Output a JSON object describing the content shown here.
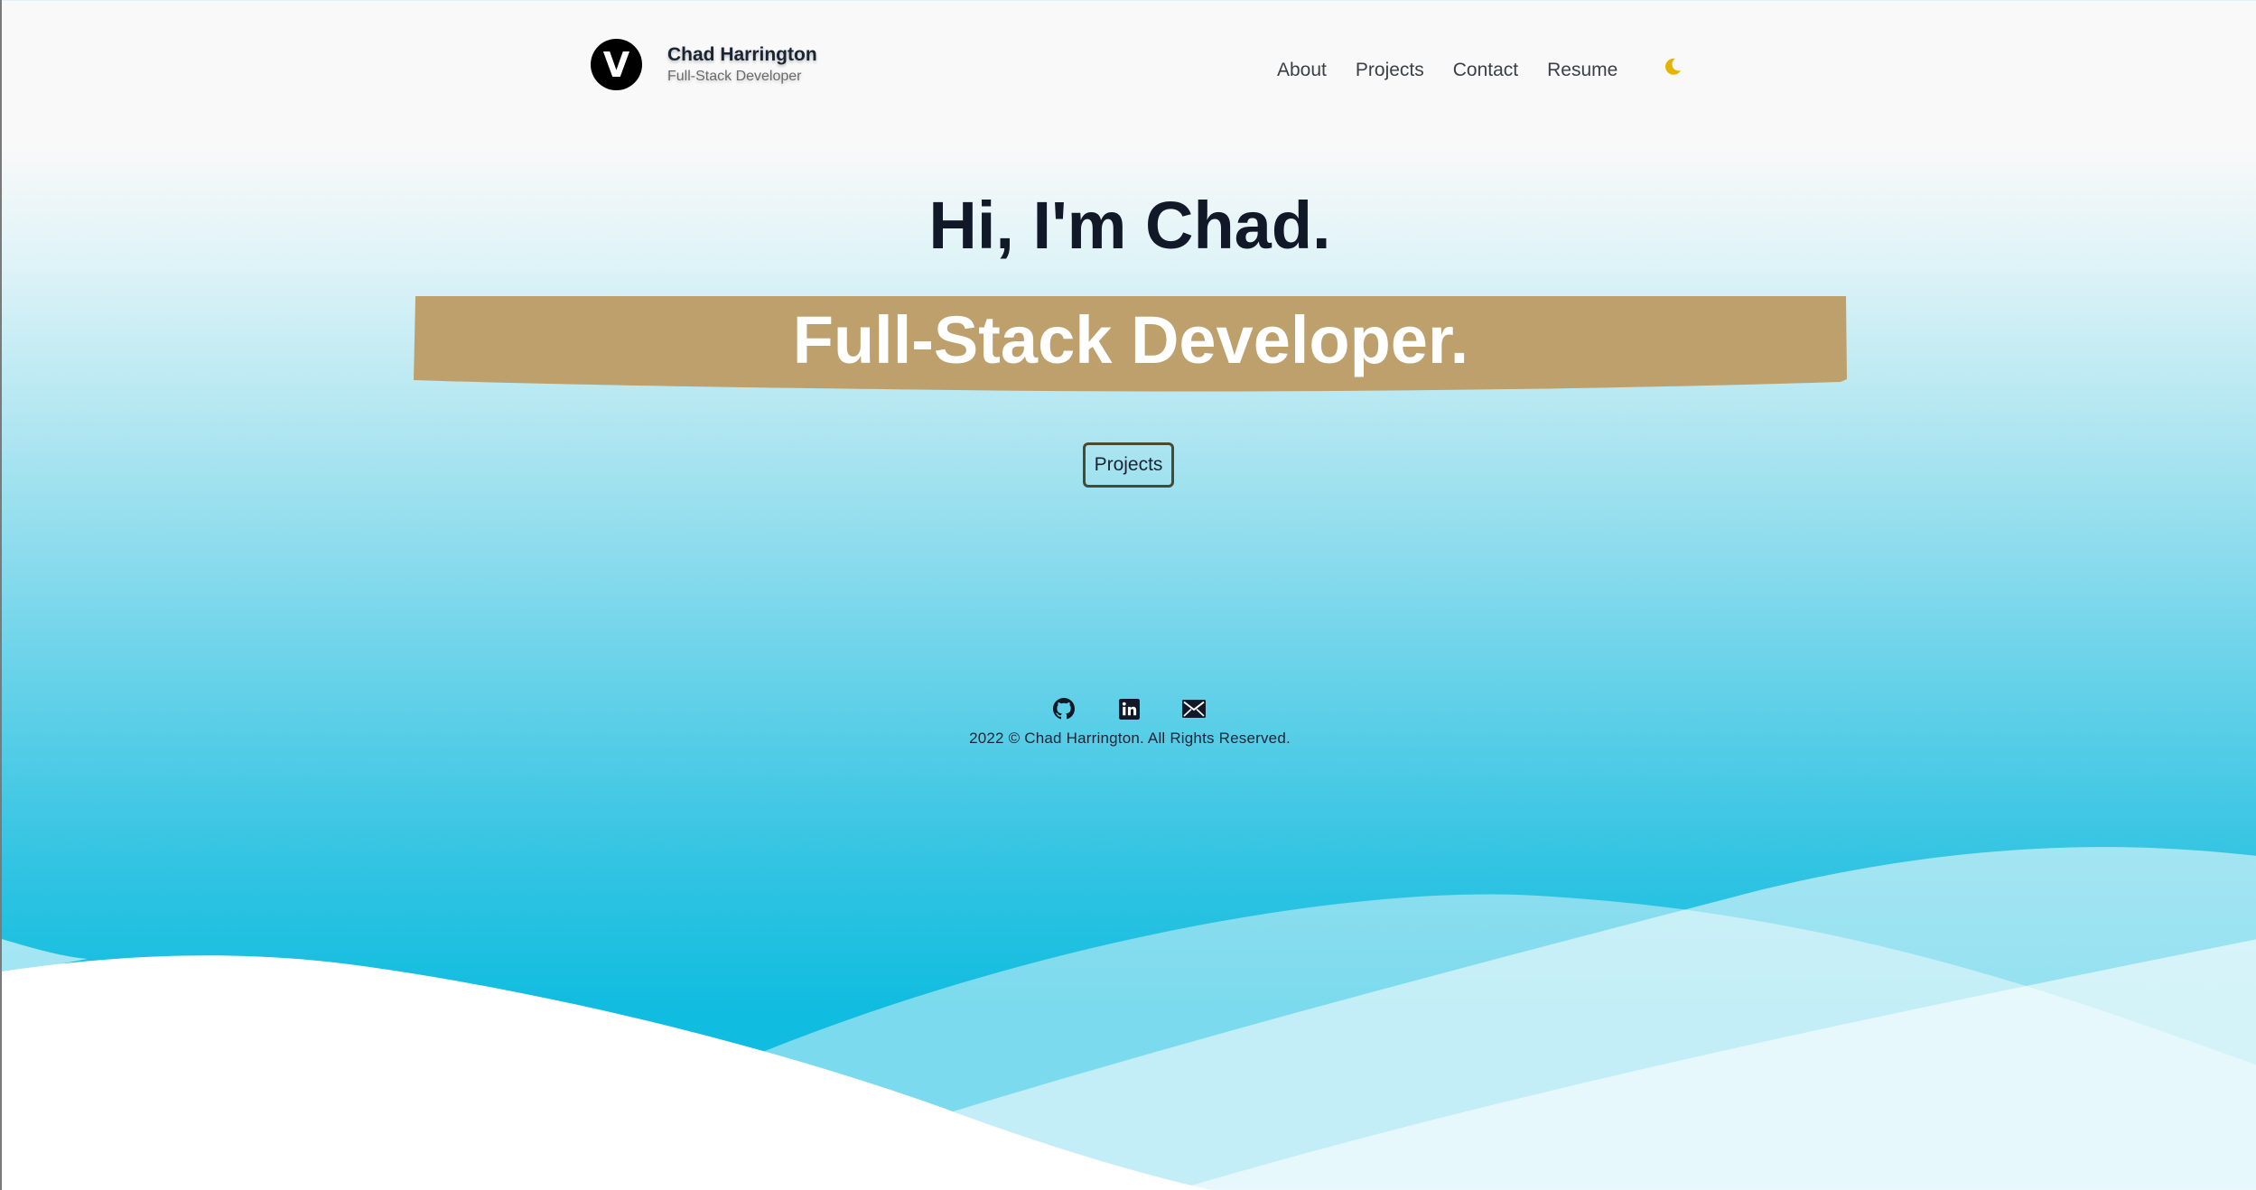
{
  "brand": {
    "logo_letter": "V",
    "name": "Chad Harrington",
    "subtitle": "Full-Stack Developer"
  },
  "nav": {
    "items": [
      {
        "label": "About"
      },
      {
        "label": "Projects"
      },
      {
        "label": "Contact"
      },
      {
        "label": "Resume"
      }
    ],
    "theme_icon": "moon-icon",
    "theme_icon_color": "#e6b400"
  },
  "hero": {
    "greeting": "Hi, I'm Chad.",
    "role": "Full-Stack Developer.",
    "banner_color": "#bea06d",
    "button_label": "Projects"
  },
  "footer": {
    "social": [
      {
        "icon": "github-icon"
      },
      {
        "icon": "linkedin-icon"
      },
      {
        "icon": "mail-icon"
      }
    ],
    "copyright": "2022 © Chad Harrington. All Rights Reserved."
  },
  "colors": {
    "background_top": "#f9f9f9",
    "background_bottom": "#10bcdf",
    "text_dark": "#111827"
  }
}
